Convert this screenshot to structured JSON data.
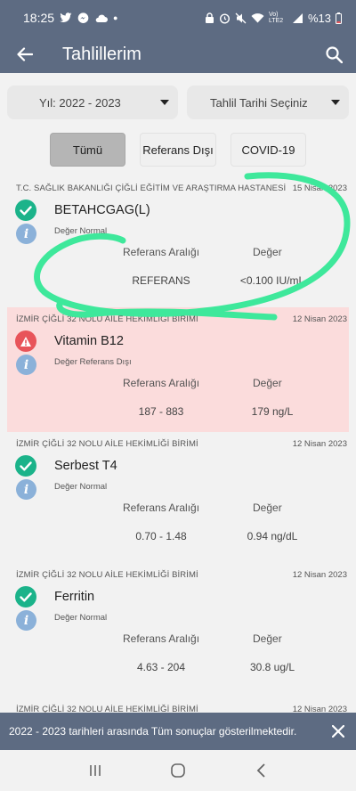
{
  "status_bar": {
    "time": "18:25",
    "battery": "%13",
    "network_label": "Vo) LTE2"
  },
  "app_bar": {
    "title": "Tahlillerim",
    "back_icon": "arrow-left-icon",
    "search_icon": "search-icon"
  },
  "filters": {
    "year_select": {
      "value": "Yıl: 2022 - 2023"
    },
    "date_select": {
      "value": "Tahlil Tarihi Seçiniz"
    }
  },
  "tabs": [
    {
      "label": "Tümü",
      "active": true
    },
    {
      "label": "Referans Dışı",
      "active": false
    },
    {
      "label": "COVID-19",
      "active": false
    }
  ],
  "results": [
    {
      "org": "T.C. SAĞLIK BAKANLIĞI ÇİĞLİ EĞİTİM VE ARAŞTIRMA HASTANESİ",
      "date": "15 Nisan 2023",
      "status": "normal",
      "name": "BETAHCGAG(L)",
      "state": "Değer Normal",
      "ref_header": "Referans Aralığı",
      "val_header": "Değer",
      "ref": "REFERANS",
      "value": "<0.100 IU/mL"
    },
    {
      "org": "İZMİR ÇİĞLİ 32 NOLU AİLE HEKİMLİĞİ BİRİMİ",
      "date": "12 Nisan 2023",
      "status": "alert",
      "name": "Vitamin B12",
      "state": "Değer Referans Dışı",
      "ref_header": "Referans Aralığı",
      "val_header": "Değer",
      "ref": "187 - 883",
      "value": "179 ng/L"
    },
    {
      "org": "İZMİR ÇİĞLİ 32 NOLU AİLE HEKİMLİĞİ BİRİMİ",
      "date": "12 Nisan 2023",
      "status": "normal",
      "name": "Serbest T4",
      "state": "Değer Normal",
      "ref_header": "Referans Aralığı",
      "val_header": "Değer",
      "ref": "0.70 - 1.48",
      "value": "0.94 ng/dL"
    },
    {
      "org": "İZMİR ÇİĞLİ 32 NOLU AİLE HEKİMLİĞİ BİRİMİ",
      "date": "12 Nisan 2023",
      "status": "normal",
      "name": "Ferritin",
      "state": "Değer Normal",
      "ref_header": "Referans Aralığı",
      "val_header": "Değer",
      "ref": "4.63 - 204",
      "value": "30.8 ug/L"
    },
    {
      "org": "İZMİR ÇİĞLİ 32 NOLU AİLE HEKİMLİĞİ BİRİMİ",
      "date": "12 Nisan 2023"
    }
  ],
  "snackbar": {
    "message": "2022 - 2023 tarihleri arasında Tüm sonuçlar gösterilmektedir."
  },
  "colors": {
    "header": "#5d6b82",
    "ok": "#1bb38a",
    "alert": "#e8545a",
    "alert_bg": "#fbdcdc",
    "info": "#8bb1d9",
    "highlight": "#3ee89b"
  }
}
